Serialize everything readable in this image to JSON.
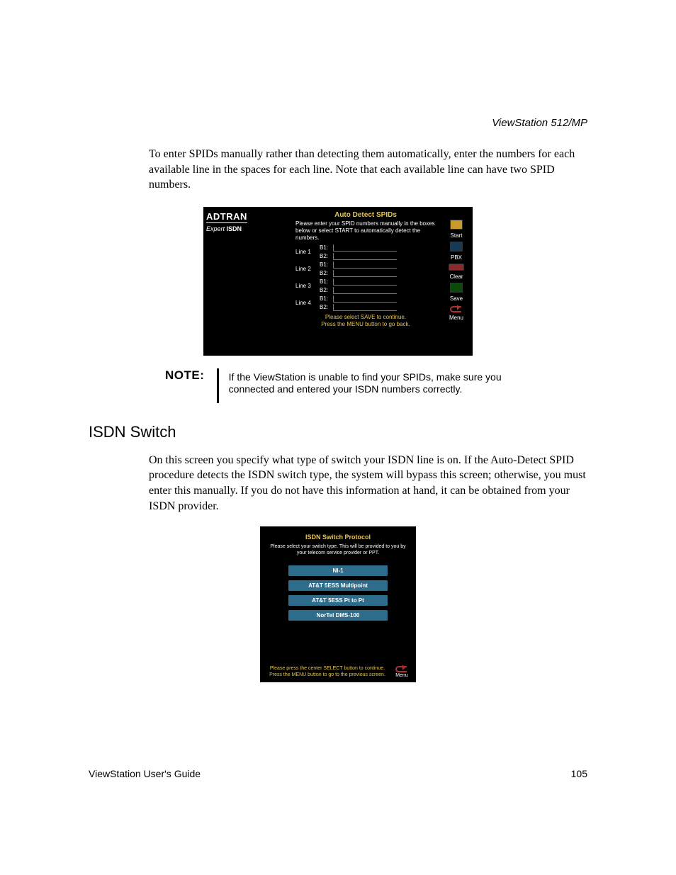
{
  "header": {
    "running": "ViewStation 512/MP"
  },
  "intro": "To enter SPIDs manually rather than detecting them automatically, enter the numbers for each available line in the spaces for each line. Note that each available line can have two SPID numbers.",
  "shot1": {
    "brand_top": "ADTRAN",
    "brand_sub_italic": "Expert",
    "brand_sub_bold": "ISDN",
    "title": "Auto Detect SPIDs",
    "desc": "Please enter your SPID numbers manually in the boxes below or select START to automatically detect the numbers.",
    "lines": [
      {
        "label": "Line 1",
        "b1": "B1:",
        "b2": "B2:"
      },
      {
        "label": "Line 2",
        "b1": "B1:",
        "b2": "B2:"
      },
      {
        "label": "Line 3",
        "b1": "B1:",
        "b2": "B2:"
      },
      {
        "label": "Line 4",
        "b1": "B1:",
        "b2": "B2:"
      }
    ],
    "foot1": "Please select SAVE to continue.",
    "foot2": "Press the MENU button to go back.",
    "side": {
      "start": "Start",
      "pbx": "PBX",
      "clear": "Clear",
      "save": "Save",
      "menu": "Menu"
    }
  },
  "note": {
    "label": "NOTE:",
    "text": "If the ViewStation is unable to find your SPIDs, make sure you connected and entered your ISDN numbers correctly."
  },
  "section": {
    "heading": "ISDN Switch",
    "para": "On this screen you specify what type of switch your ISDN line is on. If the Auto-Detect SPID procedure detects the ISDN switch type, the system will bypass this screen; otherwise, you must enter this manually. If you do not have this information at hand, it can be obtained from your ISDN provider."
  },
  "shot2": {
    "title": "ISDN Switch Protocol",
    "desc": "Please select your switch type. This will be provided to you by your telecom service provider or PPT.",
    "options": [
      "NI-1",
      "AT&T 5ESS Multipoint",
      "AT&T 5ESS Pt to Pt",
      "NorTel DMS-100"
    ],
    "foot": "Please press the center SELECT button to continue. Press the MENU button to go to the previous screen.",
    "menu": "Menu"
  },
  "footer": {
    "left": "ViewStation User's Guide",
    "right": "105"
  }
}
